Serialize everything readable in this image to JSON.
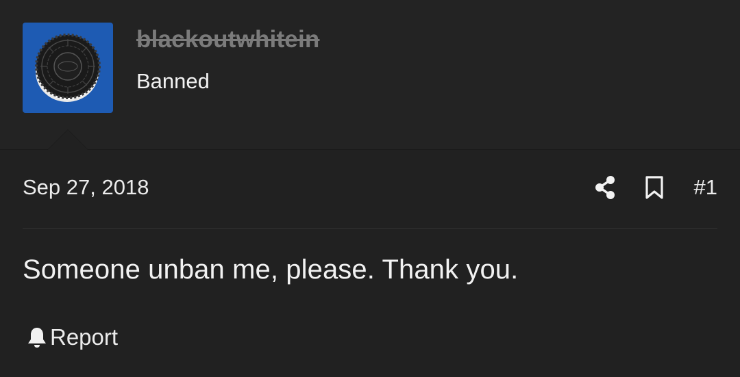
{
  "user": {
    "username": "blackoutwhitein",
    "title": "Banned",
    "avatar_icon": "oreo-cookie-avatar",
    "avatar_bg": "#1e5bb3"
  },
  "post": {
    "date": "Sep 27, 2018",
    "number": "#1",
    "message": "Someone unban me, please. Thank you.",
    "report_label": "Report",
    "icons": [
      "share-icon",
      "bookmark-icon",
      "bell-icon"
    ]
  },
  "colors": {
    "background": "#212121",
    "username_banned": "#7b7b7b",
    "text": "#ececec"
  }
}
